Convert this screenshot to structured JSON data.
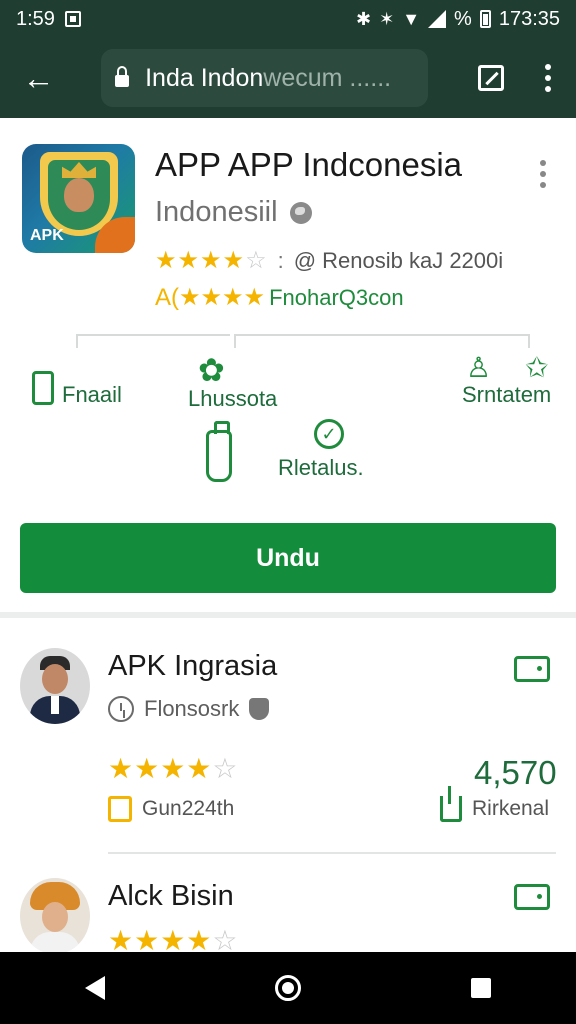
{
  "status_bar": {
    "time": "1:59",
    "right_text": "%",
    "clock_right": "173:35"
  },
  "toolbar": {
    "url_main": "Inda Indon",
    "url_faded": "wecum ......",
    "back_icon": "arrow-back-icon",
    "share_icon": "share-box-icon",
    "menu_icon": "more-vert-icon"
  },
  "app": {
    "icon_label": "APK",
    "title": "APP APP Indconesia",
    "developer": "Indonesiil",
    "rating_stars": 4,
    "rating_meta": "@ Renosib kaJ 2200i",
    "badge_prefix": "A(",
    "badge_stars": "★★★★",
    "badge_label": "FnoharQ3con"
  },
  "actions": {
    "a1": "Fnaail",
    "a2": "Lhussota",
    "a3": "Srntatem",
    "a4": "Rletalus."
  },
  "install": {
    "label": "Undu"
  },
  "list": [
    {
      "title": "APK Ingrasia",
      "sub": "Flonsosrk",
      "stars": 4,
      "count": "4,570",
      "tag": "Gun224th",
      "action": "Rirkenal"
    },
    {
      "title": "Alck Bisin",
      "stars": 4
    }
  ],
  "colors": {
    "header_bg": "#1f3d31",
    "accent_green": "#138d3b",
    "star_yellow": "#f4b400"
  }
}
